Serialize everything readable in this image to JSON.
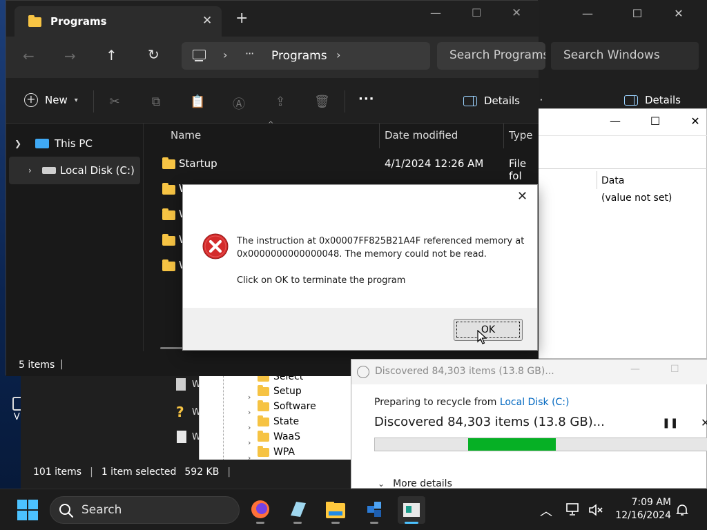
{
  "desktop": {
    "icon_label": "VL"
  },
  "back_explorer": {
    "search_placeholder": "Search Windows",
    "details_label": "Details",
    "more_label": "···",
    "list_items": [
      "W",
      "W",
      "W"
    ],
    "status": {
      "items": "101 items",
      "selected": "1 item selected",
      "size": "592 KB"
    }
  },
  "registry": {
    "tree_items": [
      "Select",
      "Setup",
      "Software",
      "State",
      "WaaS",
      "WPA"
    ],
    "column_data": "Data",
    "value_not_set": "(value not set)"
  },
  "explorer": {
    "tab_title": "Programs",
    "new_tab_label": "+",
    "address": {
      "ellipsis": "···",
      "location": "Programs"
    },
    "search_placeholder": "Search Programs",
    "new_label": "New",
    "more_label": "···",
    "details_label": "Details",
    "nav": {
      "this_pc": "This PC",
      "local_disk": "Local Disk (C:)"
    },
    "columns": {
      "name": "Name",
      "date": "Date modified",
      "type": "Type"
    },
    "rows": [
      {
        "name": "Startup",
        "date": "4/1/2024 12:26 AM",
        "type": "File fol"
      },
      {
        "name": "W",
        "date": "",
        "type": ""
      },
      {
        "name": "W",
        "date": "",
        "type": ""
      },
      {
        "name": "W",
        "date": "",
        "type": ""
      },
      {
        "name": "W",
        "date": "",
        "type": ""
      }
    ],
    "status": {
      "items": "5 items"
    }
  },
  "dialog": {
    "message_line1": "The instruction at 0x00007FF825B21A4F referenced memory at",
    "message_line2": "0x0000000000000048. The memory could not be read.",
    "message_line3": "Click on OK to terminate the program",
    "ok_label": "OK",
    "close_icon": "close-icon",
    "error_icon": "error-icon"
  },
  "recycle": {
    "title": "Discovered 84,303 items (13.8 GB)...",
    "preparing_prefix": "Preparing to recycle from ",
    "preparing_link": "Local Disk (C:)",
    "headline": "Discovered 84,303 items (13.8 GB)...",
    "more_details": "More details",
    "progress": {
      "start": 0.28,
      "end": 0.545
    },
    "progress_color": "#06b025",
    "link_color": "#0067c0"
  },
  "taskbar": {
    "search_placeholder": "Search",
    "time": "7:09 AM",
    "date": "12/16/2024"
  },
  "colors": {
    "explorer_bg": "#191919",
    "accent": "#4cc2ff",
    "folder": "#f7c444",
    "error_red": "#d42b2b"
  }
}
